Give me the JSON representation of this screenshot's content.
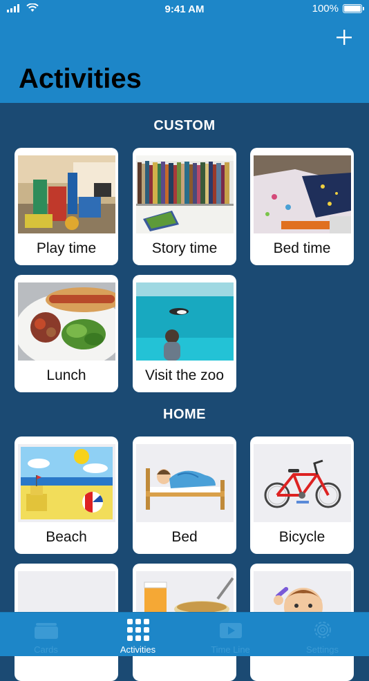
{
  "status": {
    "time": "9:41 AM",
    "battery": "100%"
  },
  "header": {
    "title": "Activities",
    "add_icon": "plus-icon"
  },
  "sections": {
    "custom": {
      "title": "CUSTOM",
      "cards": [
        {
          "label": "Play time"
        },
        {
          "label": "Story time"
        },
        {
          "label": "Bed time"
        },
        {
          "label": "Lunch"
        },
        {
          "label": "Visit the zoo"
        }
      ]
    },
    "home": {
      "title": "HOME",
      "cards": [
        {
          "label": "Beach"
        },
        {
          "label": "Bed"
        },
        {
          "label": "Bicycle"
        }
      ]
    }
  },
  "tabs": [
    {
      "label": "Cards",
      "icon": "cards-icon",
      "active": false
    },
    {
      "label": "Activities",
      "icon": "grid-icon",
      "active": true
    },
    {
      "label": "Time Line",
      "icon": "video-icon",
      "active": false
    },
    {
      "label": "Settings",
      "icon": "gear-icon",
      "active": false
    }
  ],
  "colors": {
    "header": "#1d86c8",
    "background": "#1b4a73",
    "active_tab": "#ffffff",
    "inactive_tab": "#3b9ad4"
  }
}
